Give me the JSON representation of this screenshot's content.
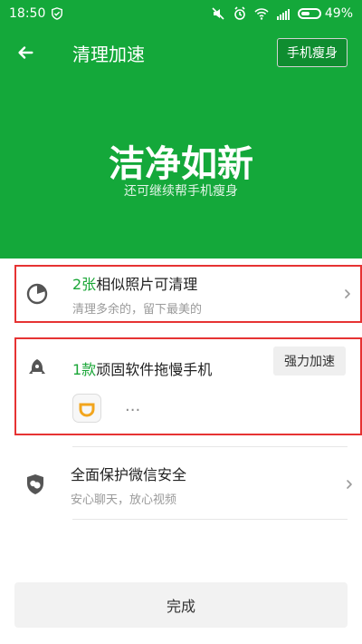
{
  "status_bar": {
    "time": "18:50",
    "battery": "49%",
    "battery_level": 0.49
  },
  "toolbar": {
    "title": "清理加速",
    "slim_button": "手机瘦身"
  },
  "hero": {
    "headline": "洁净如新",
    "subline": "还可继续帮手机瘦身"
  },
  "items": {
    "photo": {
      "count": "2张",
      "title_rest": "相似照片可清理",
      "subtitle": "清理多余的，留下最美的"
    },
    "software": {
      "count": "1款",
      "title_rest": "顽固软件拖慢手机",
      "button": "强力加速",
      "more": "···"
    },
    "wechat": {
      "title": "全面保护微信安全",
      "subtitle": "安心聊天，放心视频"
    }
  },
  "footer": {
    "done": "完成"
  },
  "colors": {
    "brand_green": "#14a83a",
    "accent_green": "#1aa637",
    "highlight_red": "#e63333"
  }
}
